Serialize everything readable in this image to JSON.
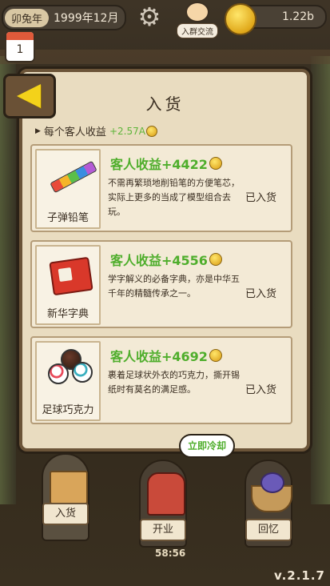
{
  "top": {
    "year_tag": "卯兔年",
    "date": "1999年12月",
    "group_label": "入群交流",
    "coins": "1.22b",
    "calendar_num": "1"
  },
  "panel": {
    "title": "入货",
    "income_label": "每个客人收益",
    "income_value": "+2.57A",
    "cards": [
      {
        "name": "子弹铅笔",
        "income": "客人收益+4422",
        "desc": "不需再繁琐地削铅笔的方便笔芯，实际上更多的当成了模型组合去玩。",
        "status": "已入货"
      },
      {
        "name": "新华字典",
        "income": "客人收益+4556",
        "desc": "学字解义的必备字典，亦是中华五千年的精髓传承之一。",
        "status": "已入货"
      },
      {
        "name": "足球巧克力",
        "income": "客人收益+4692",
        "desc": "裹着足球状外衣的巧克力，撕开锡纸时有莫名的满足感。",
        "status": "已入货"
      }
    ]
  },
  "nav": {
    "stock": "入货",
    "open": "开业",
    "memory": "回忆",
    "speech": "立即冷却",
    "timer": "58:56"
  },
  "version": "v.2.1.7",
  "icons": [
    "gear-icon",
    "coin-icon",
    "calendar-icon",
    "back-arrow-icon",
    "pencil-icon",
    "dictionary-icon",
    "chocolate-ball-icon",
    "box-icon",
    "stall-icon",
    "basket-icon"
  ]
}
